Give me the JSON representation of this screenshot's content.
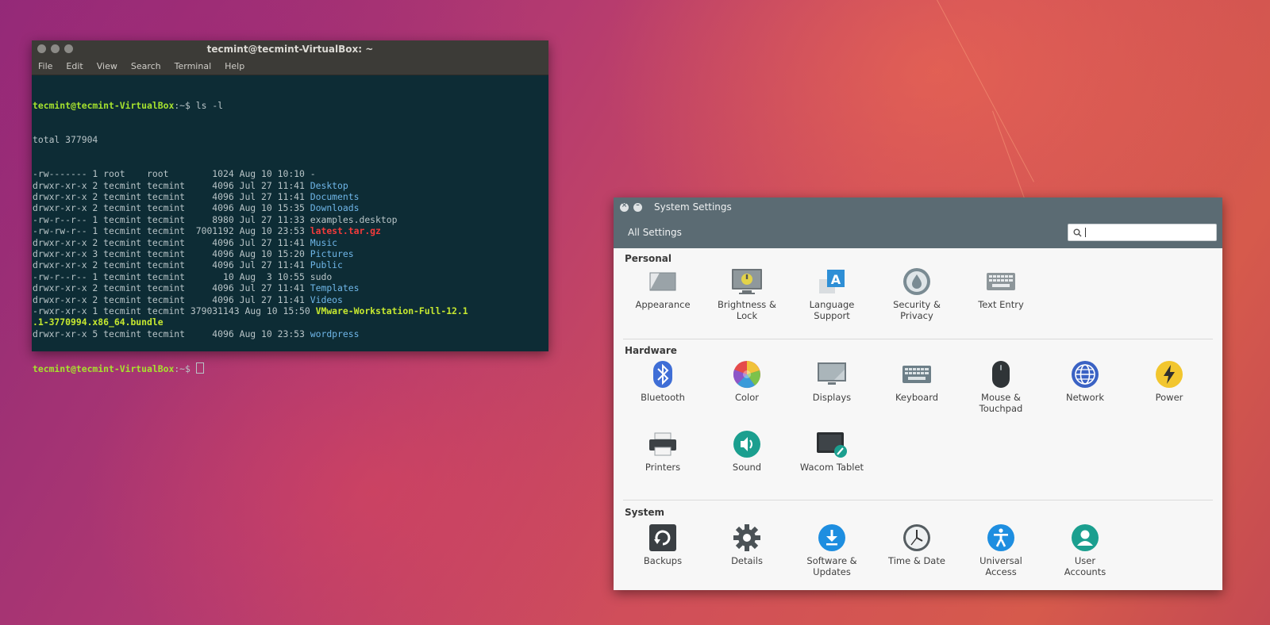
{
  "terminal": {
    "title": "tecmint@tecmint-VirtualBox: ~",
    "menu": [
      "File",
      "Edit",
      "View",
      "Search",
      "Terminal",
      "Help"
    ],
    "prompt": "tecmint@tecmint-VirtualBox",
    "prompt_suffix": ":~$",
    "command": " ls -l",
    "total": "total 377904",
    "rows": [
      {
        "meta": "-rw------- 1 root    root        1024 Aug 10 10:10 ",
        "name": "-",
        "style": "plain"
      },
      {
        "meta": "drwxr-xr-x 2 tecmint tecmint     4096 Jul 27 11:41 ",
        "name": "Desktop",
        "style": "dir"
      },
      {
        "meta": "drwxr-xr-x 2 tecmint tecmint     4096 Jul 27 11:41 ",
        "name": "Documents",
        "style": "dir"
      },
      {
        "meta": "drwxr-xr-x 2 tecmint tecmint     4096 Aug 10 15:35 ",
        "name": "Downloads",
        "style": "dir"
      },
      {
        "meta": "-rw-r--r-- 1 tecmint tecmint     8980 Jul 27 11:33 ",
        "name": "examples.desktop",
        "style": "plain"
      },
      {
        "meta": "-rw-rw-r-- 1 tecmint tecmint  7001192 Aug 10 23:53 ",
        "name": "latest.tar.gz",
        "style": "red"
      },
      {
        "meta": "drwxr-xr-x 2 tecmint tecmint     4096 Jul 27 11:41 ",
        "name": "Music",
        "style": "dir"
      },
      {
        "meta": "drwxr-xr-x 3 tecmint tecmint     4096 Aug 10 15:20 ",
        "name": "Pictures",
        "style": "dir"
      },
      {
        "meta": "drwxr-xr-x 2 tecmint tecmint     4096 Jul 27 11:41 ",
        "name": "Public",
        "style": "dir"
      },
      {
        "meta": "-rw-r--r-- 1 tecmint tecmint       10 Aug  3 10:55 ",
        "name": "sudo",
        "style": "plain"
      },
      {
        "meta": "drwxr-xr-x 2 tecmint tecmint     4096 Jul 27 11:41 ",
        "name": "Templates",
        "style": "dir"
      },
      {
        "meta": "drwxr-xr-x 2 tecmint tecmint     4096 Jul 27 11:41 ",
        "name": "Videos",
        "style": "dir"
      },
      {
        "meta": "-rwxr-xr-x 1 tecmint tecmint 379031143 Aug 10 15:50 ",
        "name": "VMware-Workstation-Full-12.1",
        "style": "green"
      },
      {
        "meta": "",
        "name": ".1-3770994.x86_64.bundle",
        "style": "green"
      },
      {
        "meta": "drwxr-xr-x 5 tecmint tecmint     4096 Aug 10 23:53 ",
        "name": "wordpress",
        "style": "dir"
      }
    ]
  },
  "settings": {
    "title": "System Settings",
    "all_settings": "All Settings",
    "search_placeholder": "",
    "sections": [
      {
        "title": "Personal",
        "items": [
          {
            "label": "Appearance",
            "icon": "appearance-icon"
          },
          {
            "label": "Brightness &\nLock",
            "icon": "brightness-lock-icon"
          },
          {
            "label": "Language\nSupport",
            "icon": "language-support-icon"
          },
          {
            "label": "Security &\nPrivacy",
            "icon": "security-privacy-icon"
          },
          {
            "label": "Text Entry",
            "icon": "text-entry-icon"
          }
        ]
      },
      {
        "title": "Hardware",
        "items": [
          {
            "label": "Bluetooth",
            "icon": "bluetooth-icon"
          },
          {
            "label": "Color",
            "icon": "color-icon"
          },
          {
            "label": "Displays",
            "icon": "displays-icon"
          },
          {
            "label": "Keyboard",
            "icon": "keyboard-icon"
          },
          {
            "label": "Mouse &\nTouchpad",
            "icon": "mouse-touchpad-icon"
          },
          {
            "label": "Network",
            "icon": "network-icon"
          },
          {
            "label": "Power",
            "icon": "power-icon"
          },
          {
            "label": "Printers",
            "icon": "printers-icon"
          },
          {
            "label": "Sound",
            "icon": "sound-icon"
          },
          {
            "label": "Wacom Tablet",
            "icon": "wacom-tablet-icon"
          }
        ]
      },
      {
        "title": "System",
        "items": [
          {
            "label": "Backups",
            "icon": "backups-icon"
          },
          {
            "label": "Details",
            "icon": "details-icon"
          },
          {
            "label": "Software &\nUpdates",
            "icon": "software-updates-icon"
          },
          {
            "label": "Time & Date",
            "icon": "time-date-icon"
          },
          {
            "label": "Universal\nAccess",
            "icon": "universal-access-icon"
          },
          {
            "label": "User\nAccounts",
            "icon": "user-accounts-icon"
          }
        ]
      }
    ]
  },
  "colors": {
    "terminal_bg": "#0d2c35",
    "prompt": "#a6e22e",
    "dir": "#6fb6e8",
    "archive": "#f23b3b",
    "executable": "#c6e830",
    "settings_header": "#5b6b73"
  }
}
